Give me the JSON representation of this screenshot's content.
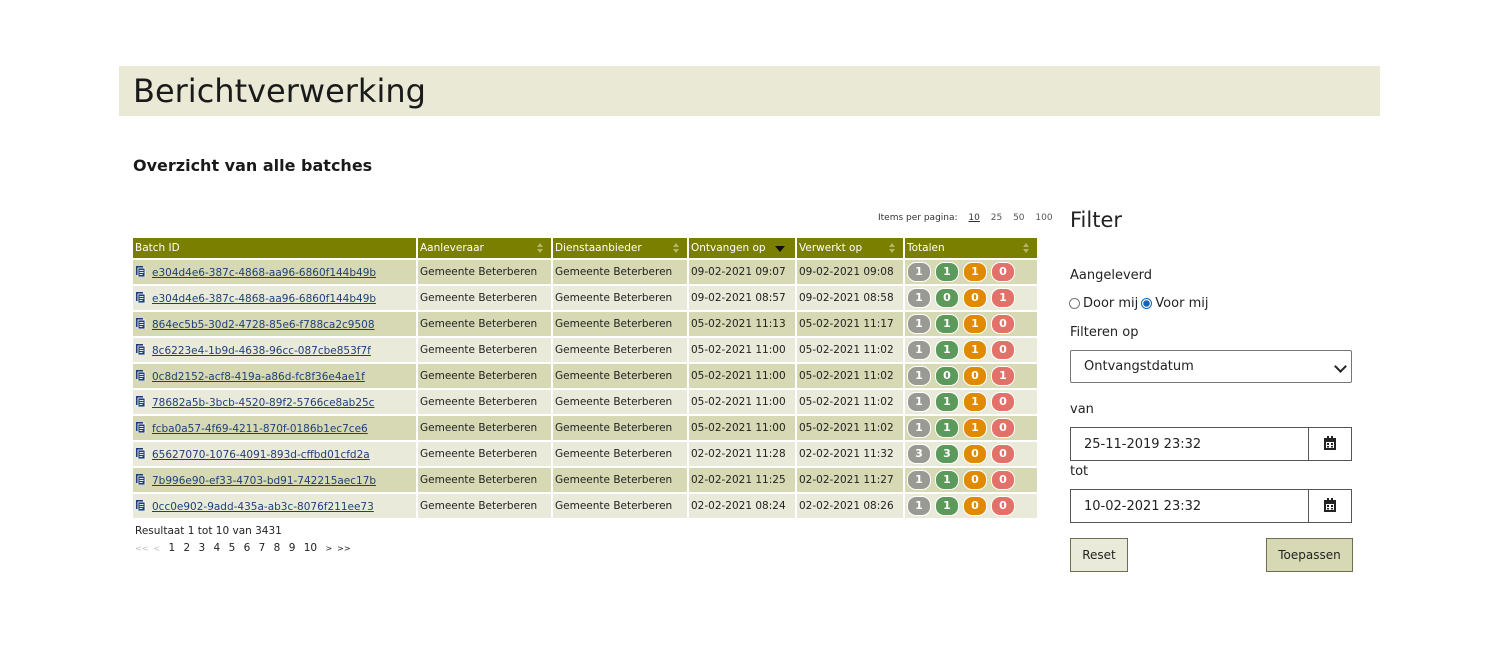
{
  "header": {
    "title": "Berichtverwerking"
  },
  "main": {
    "subtitle": "Overzicht van alle batches",
    "items_per_page": {
      "label": "Items per pagina:",
      "options": [
        "10",
        "25",
        "50",
        "100"
      ],
      "selected": "10"
    },
    "table": {
      "columns": [
        "Batch ID",
        "Aanleveraar",
        "Dienstaanbieder",
        "Ontvangen op",
        "Verwerkt op",
        "Totalen"
      ],
      "sort_column": "Ontvangen op",
      "rows": [
        {
          "id": "e304d4e6-387c-4868-aa96-6860f144b49b",
          "aanleveraar": "Gemeente Beterberen",
          "dienstaanbieder": "Gemeente Beterberen",
          "ontvangen": "09-02-2021 09:07",
          "verwerkt": "09-02-2021 09:08",
          "totalen": [
            "1",
            "1",
            "1",
            "0"
          ]
        },
        {
          "id": "e304d4e6-387c-4868-aa96-6860f144b49b",
          "aanleveraar": "Gemeente Beterberen",
          "dienstaanbieder": "Gemeente Beterberen",
          "ontvangen": "09-02-2021 08:57",
          "verwerkt": "09-02-2021 08:58",
          "totalen": [
            "1",
            "0",
            "0",
            "1"
          ]
        },
        {
          "id": "864ec5b5-30d2-4728-85e6-f788ca2c9508",
          "aanleveraar": "Gemeente Beterberen",
          "dienstaanbieder": "Gemeente Beterberen",
          "ontvangen": "05-02-2021 11:13",
          "verwerkt": "05-02-2021 11:17",
          "totalen": [
            "1",
            "1",
            "1",
            "0"
          ]
        },
        {
          "id": "8c6223e4-1b9d-4638-96cc-087cbe853f7f",
          "aanleveraar": "Gemeente Beterberen",
          "dienstaanbieder": "Gemeente Beterberen",
          "ontvangen": "05-02-2021 11:00",
          "verwerkt": "05-02-2021 11:02",
          "totalen": [
            "1",
            "1",
            "1",
            "0"
          ]
        },
        {
          "id": "0c8d2152-acf8-419a-a86d-fc8f36e4ae1f",
          "aanleveraar": "Gemeente Beterberen",
          "dienstaanbieder": "Gemeente Beterberen",
          "ontvangen": "05-02-2021 11:00",
          "verwerkt": "05-02-2021 11:02",
          "totalen": [
            "1",
            "0",
            "0",
            "1"
          ]
        },
        {
          "id": "78682a5b-3bcb-4520-89f2-5766ce8ab25c",
          "aanleveraar": "Gemeente Beterberen",
          "dienstaanbieder": "Gemeente Beterberen",
          "ontvangen": "05-02-2021 11:00",
          "verwerkt": "05-02-2021 11:02",
          "totalen": [
            "1",
            "1",
            "1",
            "0"
          ]
        },
        {
          "id": "fcba0a57-4f69-4211-870f-0186b1ec7ce6",
          "aanleveraar": "Gemeente Beterberen",
          "dienstaanbieder": "Gemeente Beterberen",
          "ontvangen": "05-02-2021 11:00",
          "verwerkt": "05-02-2021 11:02",
          "totalen": [
            "1",
            "1",
            "1",
            "0"
          ]
        },
        {
          "id": "65627070-1076-4091-893d-cffbd01cfd2a",
          "aanleveraar": "Gemeente Beterberen",
          "dienstaanbieder": "Gemeente Beterberen",
          "ontvangen": "02-02-2021 11:28",
          "verwerkt": "02-02-2021 11:32",
          "totalen": [
            "3",
            "3",
            "0",
            "0"
          ]
        },
        {
          "id": "7b996e90-ef33-4703-bd91-742215aec17b",
          "aanleveraar": "Gemeente Beterberen",
          "dienstaanbieder": "Gemeente Beterberen",
          "ontvangen": "02-02-2021 11:25",
          "verwerkt": "02-02-2021 11:27",
          "totalen": [
            "1",
            "1",
            "0",
            "0"
          ]
        },
        {
          "id": "0cc0e902-9add-435a-ab3c-8076f211ee73",
          "aanleveraar": "Gemeente Beterberen",
          "dienstaanbieder": "Gemeente Beterberen",
          "ontvangen": "02-02-2021 08:24",
          "verwerkt": "02-02-2021 08:26",
          "totalen": [
            "1",
            "1",
            "0",
            "0"
          ]
        }
      ],
      "totalen_colors": [
        "#9a9a94",
        "#5c9a5c",
        "#e08a00",
        "#e2716a"
      ]
    },
    "result_text": "Resultaat 1 tot 10 van 3431",
    "pagination": {
      "first": "<<",
      "prev": "<",
      "pages": [
        "1",
        "2",
        "3",
        "4",
        "5",
        "6",
        "7",
        "8",
        "9",
        "10"
      ],
      "next": ">",
      "last": ">>",
      "current": "1"
    }
  },
  "filter": {
    "title": "Filter",
    "aangeleverd_label": "Aangeleverd",
    "radio_door_mij": "Door mij",
    "radio_voor_mij": "Voor mij",
    "radio_selected": "Voor mij",
    "filteren_op_label": "Filteren op",
    "filteren_op_value": "Ontvangstdatum",
    "van_label": "van",
    "van_value": "25-11-2019 23:32",
    "tot_label": "tot",
    "tot_value": "10-02-2021 23:32",
    "reset_label": "Reset",
    "apply_label": "Toepassen"
  },
  "colors": {
    "header_bg": "#e9e9d6",
    "table_header": "#7b7f00",
    "row_a": "#d6d9b4",
    "row_b": "#eaeadb",
    "link": "#1d3f7a"
  }
}
